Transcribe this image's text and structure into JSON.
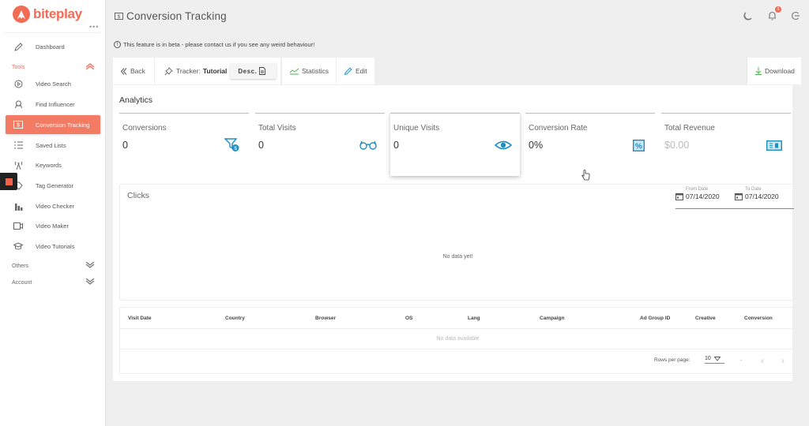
{
  "brand": {
    "name": "biteplay",
    "menu_dots": "•••",
    "accent": "#f26b55"
  },
  "sidebar": {
    "items": [
      {
        "label": "Dashboard",
        "icon": "pencil-icon"
      },
      {
        "label": "Video Search",
        "icon": "play-circle-icon"
      },
      {
        "label": "Find Influencer",
        "icon": "influencer-icon"
      },
      {
        "label": "Conversion Tracking",
        "icon": "dollar-bill-icon",
        "active": true
      },
      {
        "label": "Saved Lists",
        "icon": "list-icon"
      },
      {
        "label": "Keywords",
        "icon": "antenna-icon"
      },
      {
        "label": "Tag Generator",
        "icon": "tag-icon"
      },
      {
        "label": "Video Checker",
        "icon": "bar-chart-icon"
      },
      {
        "label": "Video Maker",
        "icon": "video-camera-icon"
      },
      {
        "label": "Video Tutorials",
        "icon": "graduation-cap-icon"
      }
    ],
    "sections": {
      "tools": "Tools",
      "others": "Others",
      "account": "Account"
    }
  },
  "header": {
    "title": "Conversion Tracking",
    "notification_count": "3",
    "beta_note": "This feature is in beta - please contact us if you see any weird behaviour!"
  },
  "toolbar": {
    "back": "Back",
    "tracker_label": "Tracker:",
    "tracker_name": "Tutorial",
    "desc": "Desc.",
    "statistics": "Statistics",
    "edit": "Edit",
    "download": "Download"
  },
  "analytics": {
    "title": "Analytics",
    "stats": [
      {
        "label": "Conversions",
        "value": "0",
        "icon": "funnel-dollar-icon"
      },
      {
        "label": "Total Visits",
        "value": "0",
        "icon": "glasses-icon"
      },
      {
        "label": "Unique Visits",
        "value": "0",
        "icon": "eye-icon"
      },
      {
        "label": "Conversion Rate",
        "value": "0%",
        "icon": "percent-icon"
      },
      {
        "label": "Total Revenue",
        "value": "$0.00",
        "icon": "money-bill-icon"
      }
    ],
    "icon_color": "#1f8fc1"
  },
  "clicks": {
    "title": "Clicks",
    "from_label": "From Date",
    "from_value": "07/14/2020",
    "to_label": "To Date",
    "to_value": "07/14/2020",
    "empty": "No data yet!"
  },
  "table": {
    "columns": [
      "Visit Date",
      "Country",
      "Browser",
      "OS",
      "Lang",
      "Campaign",
      "Ad Group ID",
      "Creative",
      "Conversion"
    ],
    "empty": "No data available",
    "rows_per_page_label": "Rows per page:",
    "rows_per_page": "10",
    "range": "-"
  }
}
